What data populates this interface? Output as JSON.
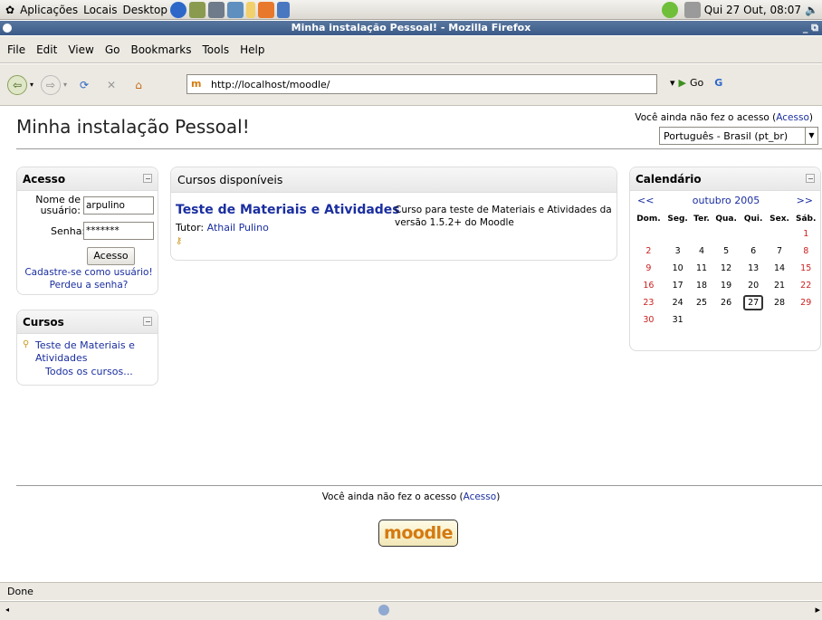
{
  "panel": {
    "apps": "Aplicações",
    "places": "Locais",
    "desktop": "Desktop",
    "clock": "Qui 27 Out, 08:07"
  },
  "window": {
    "title": "Minha instalação Pessoal! - Mozilla Firefox"
  },
  "menubar": [
    "File",
    "Edit",
    "View",
    "Go",
    "Bookmarks",
    "Tools",
    "Help"
  ],
  "toolbar": {
    "url": "http://localhost/moodle/",
    "go_label": "Go"
  },
  "header": {
    "site_title": "Minha instalação Pessoal!",
    "login_status_prefix": "Você ainda não fez o acesso (",
    "login_link": "Acesso",
    "login_status_suffix": ")",
    "language": "Português - Brasil (pt_br)"
  },
  "login_block": {
    "title": "Acesso",
    "username_label_1": "Nome de",
    "username_label_2": "usuário:",
    "username_value": "arpulino",
    "password_label": "Senha:",
    "password_value": "*******",
    "submit": "Acesso",
    "signup_link": "Cadastre-se como usuário!",
    "forgot_link": "Perdeu a senha?"
  },
  "courses_block": {
    "title": "Cursos",
    "course_link_1": "Teste de Materiais e",
    "course_link_2": "Atividades",
    "all_courses": "Todos os cursos..."
  },
  "main": {
    "heading": "Cursos disponíveis",
    "course_title": "Teste de Materiais e Atividades",
    "teacher_label": "Tutor: ",
    "teacher_name": "Athail Pulino",
    "summary": "Curso para teste de Materiais e Atividades da versão 1.5.2+ do Moodle"
  },
  "calendar": {
    "title": "Calendário",
    "prev": "<<",
    "month": "outubro 2005",
    "next": ">>",
    "weekdays": [
      "Dom.",
      "Seg.",
      "Ter.",
      "Qua.",
      "Qui.",
      "Sex.",
      "Sáb."
    ],
    "weeks": [
      [
        "",
        "",
        "",
        "",
        "",
        "",
        "1"
      ],
      [
        "2",
        "3",
        "4",
        "5",
        "6",
        "7",
        "8"
      ],
      [
        "9",
        "10",
        "11",
        "12",
        "13",
        "14",
        "15"
      ],
      [
        "16",
        "17",
        "18",
        "19",
        "20",
        "21",
        "22"
      ],
      [
        "23",
        "24",
        "25",
        "26",
        "27",
        "28",
        "29"
      ],
      [
        "30",
        "31",
        "",
        "",
        "",
        "",
        ""
      ]
    ],
    "today": "27"
  },
  "footer": {
    "login_status_prefix": "Você ainda não fez o acesso (",
    "login_link": "Acesso",
    "login_status_suffix": ")",
    "logo_text": "moodle"
  },
  "statusbar": {
    "text": "Done"
  }
}
